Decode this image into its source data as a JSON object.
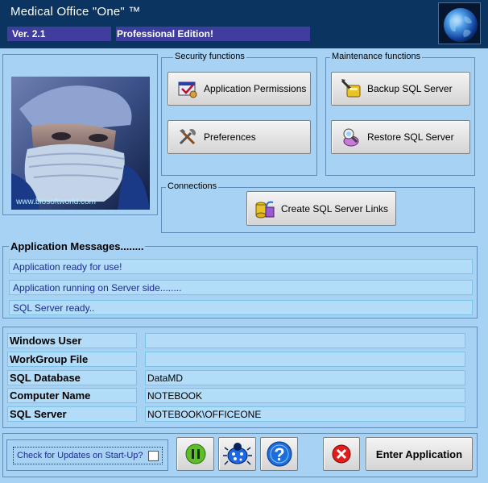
{
  "header": {
    "title": "Medical Office \"One\" ™",
    "version": "Ver. 2.1",
    "edition": "Professional Edition!"
  },
  "photo": {
    "caption": "www.biosoftworld.com"
  },
  "security": {
    "legend": "Security functions",
    "permissions_label": "Application Permissions",
    "preferences_label": "Preferences"
  },
  "maintenance": {
    "legend": "Maintenance functions",
    "backup_label": "Backup SQL Server",
    "restore_label": "Restore SQL Server"
  },
  "connections": {
    "legend": "Connections",
    "create_links_label": "Create SQL Server Links"
  },
  "messages": {
    "title": "Application Messages........",
    "items": [
      "Application ready for use!",
      "Application running on Server side........",
      "SQL Server ready.."
    ]
  },
  "info": {
    "rows": [
      {
        "label": "Windows User",
        "value": ""
      },
      {
        "label": "WorkGroup File",
        "value": ""
      },
      {
        "label": "SQL Database",
        "value": "DataMD"
      },
      {
        "label": "Computer Name",
        "value": "NOTEBOOK"
      },
      {
        "label": "SQL Server",
        "value": "NOTEBOOK\\OFFICEONE"
      }
    ]
  },
  "footer": {
    "updates_label": "Check for Updates on Start-Up?",
    "updates_checked": false,
    "enter_label": "Enter Application"
  },
  "colors": {
    "header_bg": "#0b3560",
    "version_bar": "#3f3d9e",
    "panel_bg": "#a8d2f4",
    "field_bg": "#b3dcf8",
    "message_text": "#1b2b8e"
  }
}
